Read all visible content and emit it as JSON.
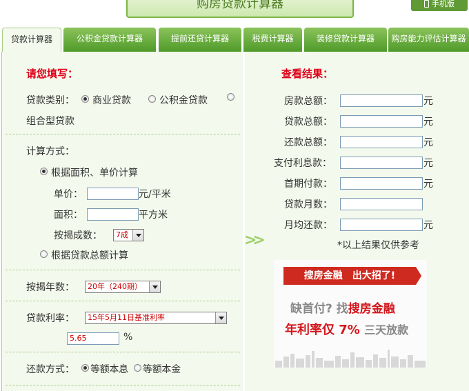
{
  "header": {
    "title": "购房贷款计算器",
    "mobile_label": "手机版"
  },
  "tabs": [
    {
      "label": "贷款计算器",
      "active": true
    },
    {
      "label": "公积金贷款计算器"
    },
    {
      "label": "提前还贷计算器"
    },
    {
      "label": "税费计算器"
    },
    {
      "label": "装修贷款计算器"
    },
    {
      "label": "购房能力评估计算器"
    }
  ],
  "form": {
    "heading": "请您填写：",
    "loan_type_label": "贷款类别：",
    "loan_types": [
      "商业贷款",
      "公积金贷款",
      "组合型贷款"
    ],
    "calc_method_label": "计算方式：",
    "method_area": "根据面积、单价计算",
    "unit_price_label": "单价：",
    "unit_price_unit": "元/平米",
    "area_label": "面积：",
    "area_unit": "平方米",
    "down_ratio_label": "按揭成数：",
    "down_ratio_value": "7成",
    "method_total": "根据贷款总额计算",
    "years_label": "按揭年数：",
    "years_value": "20年（240期）",
    "rate_label": "贷款利率：",
    "rate_select": "15年5月11日基准利率",
    "rate_value": "5.65",
    "rate_unit": "%",
    "repay_label": "还款方式：",
    "repay_options": [
      "等额本息",
      "等额本金"
    ]
  },
  "results": {
    "heading": "查看结果：",
    "rows": [
      {
        "label": "房款总额：",
        "unit": "元"
      },
      {
        "label": "贷款总额：",
        "unit": "元"
      },
      {
        "label": "还款总额：",
        "unit": "元"
      },
      {
        "label": "支付利息款：",
        "unit": "元"
      },
      {
        "label": "首期付款：",
        "unit": "元"
      },
      {
        "label": "贷款月数：",
        "unit": ""
      },
      {
        "label": "月均还款：",
        "unit": "元"
      }
    ],
    "note": "*以上结果仅供参考"
  },
  "ad": {
    "tagline": "搜房金融　出大招了!",
    "line1_a": "缺首付?",
    "line1_b": "找",
    "line1_c": "搜房金融",
    "line2_a": "年利率仅 7%",
    "line2_b": "三天放款"
  },
  "colors": {
    "accent_green": "#5f9a35",
    "accent_red": "#e0001a",
    "panel_bg": "#f3f9ec"
  }
}
